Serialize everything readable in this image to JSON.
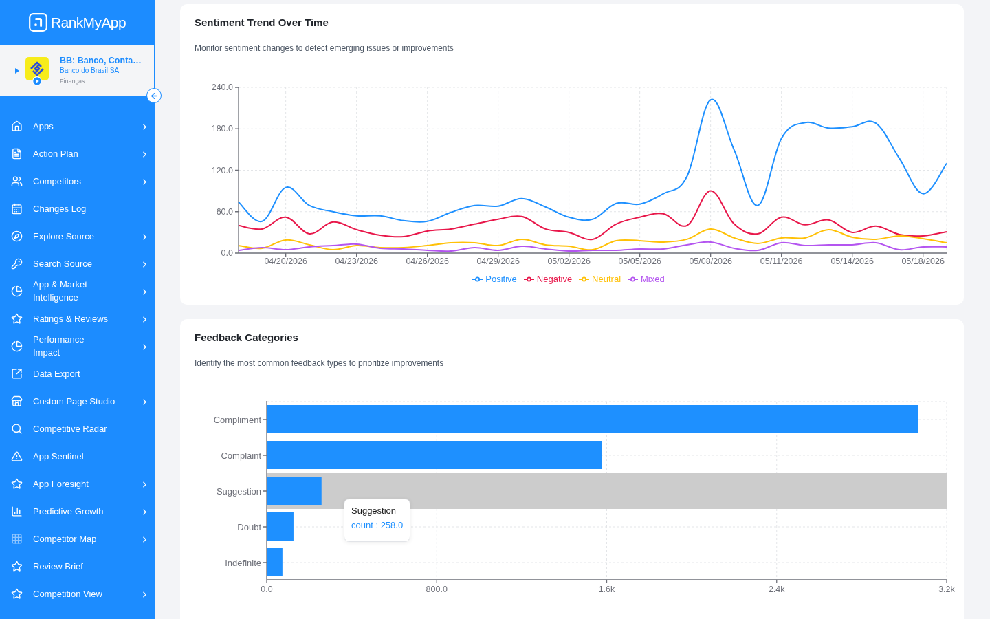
{
  "sidebar": {
    "logo": {
      "text": "RankMyApp"
    },
    "app": {
      "name": "BB: Banco, Conta…",
      "publisher": "Banco do Brasil SA",
      "category": "Finanças",
      "expanded": false
    },
    "items": [
      {
        "label": "Apps",
        "has_submenu": true
      },
      {
        "label": "Action Plan",
        "has_submenu": true
      },
      {
        "label": "Competitors",
        "has_submenu": true
      },
      {
        "label": "Changes Log",
        "has_submenu": false
      },
      {
        "label": "Explore Source",
        "has_submenu": true
      },
      {
        "label": "Search Source",
        "has_submenu": true
      },
      {
        "label": "App & Market\nIntelligence",
        "has_submenu": true
      },
      {
        "label": "Ratings & Reviews",
        "has_submenu": true
      },
      {
        "label": "Performance\nImpact",
        "has_submenu": true
      },
      {
        "label": "Data Export",
        "has_submenu": false
      },
      {
        "label": "Custom Page Studio",
        "has_submenu": true
      },
      {
        "label": "Competitive Radar",
        "has_submenu": false
      },
      {
        "label": "App Sentinel",
        "has_submenu": false
      },
      {
        "label": "App Foresight",
        "has_submenu": true
      },
      {
        "label": "Predictive Growth",
        "has_submenu": true
      },
      {
        "label": "Competitor Map",
        "has_submenu": true
      },
      {
        "label": "Review Brief",
        "has_submenu": false
      },
      {
        "label": "Competition View",
        "has_submenu": true
      }
    ]
  },
  "sentiment_trend": {
    "title": "Sentiment Trend Over Time",
    "subtitle": "Monitor sentiment changes to detect emerging issues or improvements",
    "chart_data": {
      "type": "line",
      "categories": [
        null,
        null,
        "04/20/2026",
        null,
        null,
        "04/23/2026",
        null,
        null,
        "04/26/2026",
        null,
        null,
        "04/29/2026",
        null,
        null,
        "05/02/2026",
        null,
        null,
        "05/05/2026",
        null,
        null,
        "05/08/2026",
        null,
        null,
        "05/11/2026",
        null,
        null,
        "05/14/2026",
        null,
        null,
        "05/18/2026",
        null
      ],
      "series": [
        {
          "name": "Positive",
          "color": "#1e90ff",
          "values": [
            74,
            46,
            95,
            69,
            60,
            54,
            54,
            47,
            46,
            59,
            69,
            68,
            79,
            67,
            52,
            49,
            72,
            71,
            86,
            111,
            222,
            149,
            69,
            166,
            189,
            181,
            183,
            188,
            137,
            86,
            130
          ]
        },
        {
          "name": "Negative",
          "color": "#e8174a",
          "values": [
            40,
            35,
            52,
            28,
            45,
            34,
            26,
            24,
            32,
            35,
            42,
            49,
            53,
            35,
            30,
            20,
            42,
            52,
            57,
            40,
            90,
            42,
            28,
            52,
            41,
            48,
            30,
            39,
            27,
            25,
            31
          ]
        },
        {
          "name": "Neutral",
          "color": "#ffc107",
          "values": [
            11,
            7,
            19,
            12,
            5,
            11,
            8,
            8,
            11,
            15,
            15,
            11,
            20,
            12,
            10,
            5,
            18,
            18,
            16,
            20,
            35,
            22,
            14,
            22,
            22,
            34,
            23,
            20,
            25,
            21,
            15
          ]
        },
        {
          "name": "Mixed",
          "color": "#b455f0",
          "values": [
            4,
            8,
            5,
            9,
            11,
            13,
            7,
            6,
            4,
            3,
            8,
            4,
            10,
            6,
            3,
            4,
            4,
            6,
            6,
            12,
            16,
            7,
            4,
            15,
            11,
            12,
            12,
            15,
            5,
            9,
            9
          ]
        }
      ],
      "ylim": [
        0,
        240
      ],
      "yticks": [
        {
          "value": 0,
          "label": "0.0"
        },
        {
          "value": 60,
          "label": "60.0"
        },
        {
          "value": 120,
          "label": "120.0"
        },
        {
          "value": 180,
          "label": "180.0"
        },
        {
          "value": 240,
          "label": "240.0"
        }
      ],
      "grid": true
    }
  },
  "feedback_categories": {
    "title": "Feedback Categories",
    "subtitle": "Identify the most common feedback types to prioritize improvements",
    "chart_data": {
      "type": "bar",
      "orientation": "horizontal",
      "categories": [
        "Compliment",
        "Complaint",
        "Suggestion",
        "Doubt",
        "Indefinite"
      ],
      "series": [
        {
          "color": "#1e90ff",
          "values": [
            3065,
            1576,
            258,
            126,
            74
          ]
        }
      ],
      "xlim": [
        0,
        3200
      ],
      "xticks": [
        {
          "value": 0,
          "label": "0.0"
        },
        {
          "value": 800,
          "label": "800.0"
        },
        {
          "value": 1600,
          "label": "1.6k"
        },
        {
          "value": 2400,
          "label": "2.4k"
        },
        {
          "value": 3200,
          "label": "3.2k"
        }
      ],
      "grid": true,
      "bands": [
        {
          "axis": "y",
          "from": "Suggestion",
          "to": "Suggestion",
          "color": "#cccccc"
        }
      ]
    },
    "tooltip": {
      "title": "Suggestion",
      "text": "count : 258.0"
    }
  }
}
